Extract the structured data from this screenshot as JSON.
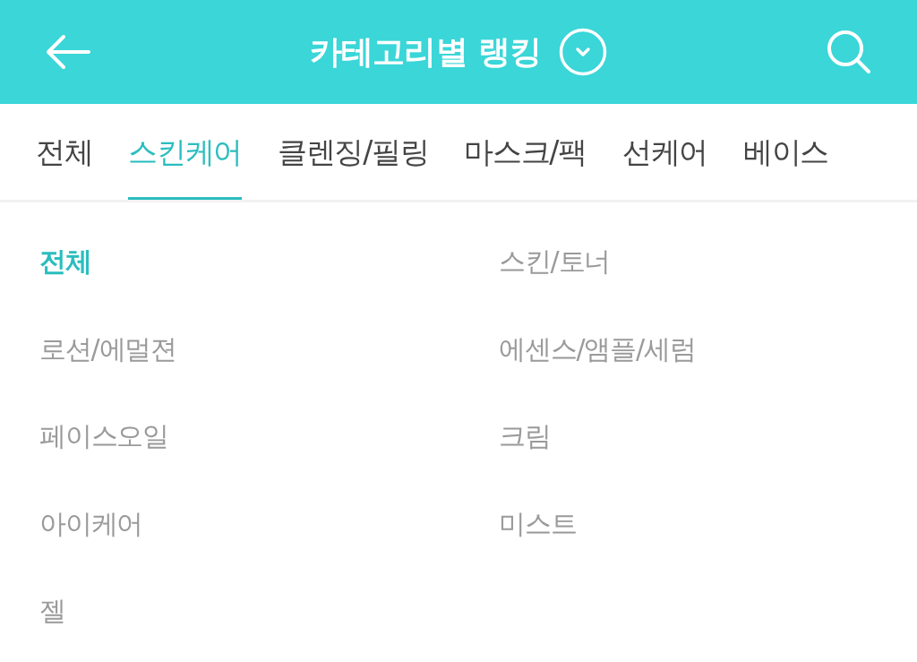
{
  "header": {
    "title": "카테고리별 랭킹"
  },
  "tabs": [
    {
      "label": "전체",
      "selected": false
    },
    {
      "label": "스킨케어",
      "selected": true
    },
    {
      "label": "클렌징/필링",
      "selected": false
    },
    {
      "label": "마스크/팩",
      "selected": false
    },
    {
      "label": "선케어",
      "selected": false
    },
    {
      "label": "베이스",
      "selected": false
    }
  ],
  "subcategories": [
    {
      "label": "전체",
      "selected": true
    },
    {
      "label": "스킨/토너",
      "selected": false
    },
    {
      "label": "로션/에멀젼",
      "selected": false
    },
    {
      "label": "에센스/앰플/세럼",
      "selected": false
    },
    {
      "label": "페이스오일",
      "selected": false
    },
    {
      "label": "크림",
      "selected": false
    },
    {
      "label": "아이케어",
      "selected": false
    },
    {
      "label": "미스트",
      "selected": false
    },
    {
      "label": "젤",
      "selected": false
    }
  ]
}
